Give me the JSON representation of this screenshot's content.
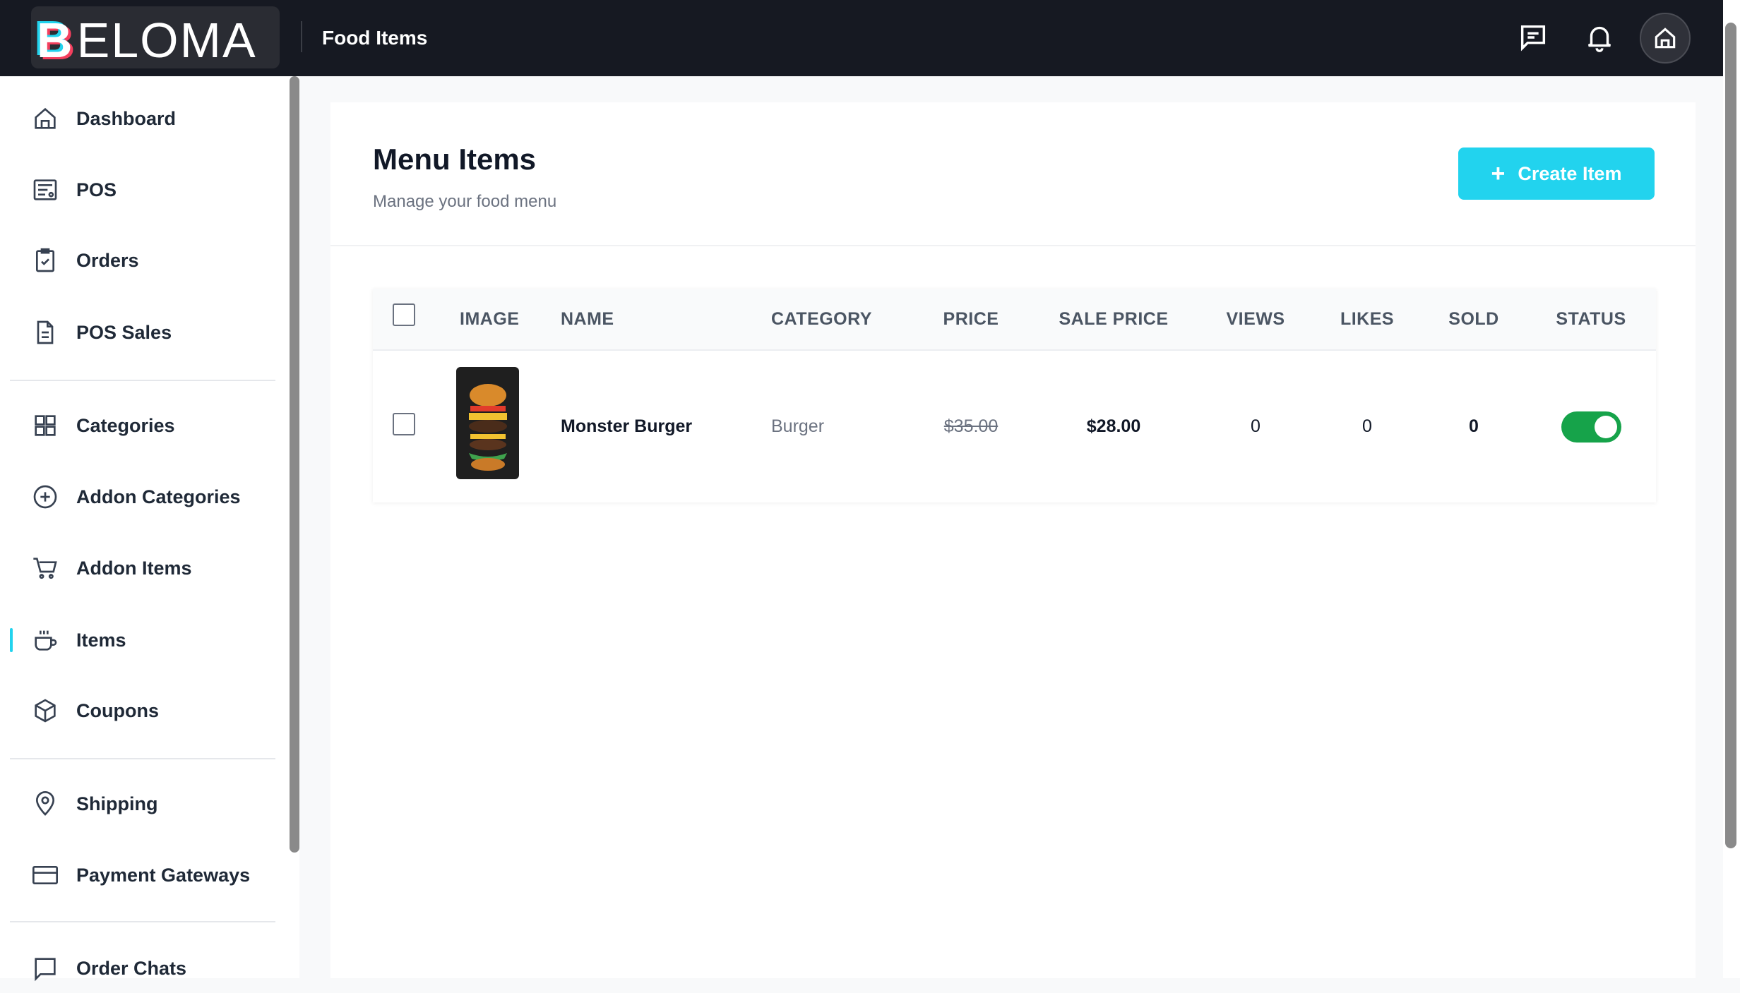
{
  "header": {
    "logo": "BELOMA",
    "page_title": "Food Items"
  },
  "sidebar": {
    "items": [
      {
        "label": "Dashboard",
        "icon": "home-icon"
      },
      {
        "label": "POS",
        "icon": "pos-icon"
      },
      {
        "label": "Orders",
        "icon": "clipboard-icon"
      },
      {
        "label": "POS Sales",
        "icon": "document-icon"
      },
      {
        "label": "Categories",
        "icon": "grid-icon"
      },
      {
        "label": "Addon Categories",
        "icon": "plus-circle-icon"
      },
      {
        "label": "Addon Items",
        "icon": "cart-icon"
      },
      {
        "label": "Items",
        "icon": "cup-icon",
        "active": true
      },
      {
        "label": "Coupons",
        "icon": "box-icon"
      },
      {
        "label": "Shipping",
        "icon": "map-pin-icon"
      },
      {
        "label": "Payment Gateways",
        "icon": "credit-card-icon"
      },
      {
        "label": "Order Chats",
        "icon": "chat-icon"
      }
    ]
  },
  "main": {
    "title": "Menu Items",
    "subtitle": "Manage your food menu",
    "create_label": "Create Item",
    "columns": [
      "IMAGE",
      "NAME",
      "CATEGORY",
      "PRICE",
      "SALE PRICE",
      "VIEWS",
      "LIKES",
      "SOLD",
      "STATUS"
    ],
    "rows": [
      {
        "name": "Monster Burger",
        "category": "Burger",
        "price": "$35.00",
        "sale_price": "$28.00",
        "views": "0",
        "likes": "0",
        "sold": "0",
        "status": true
      }
    ]
  },
  "colors": {
    "accent": "#22d3ee",
    "topbar": "#161922",
    "toggle_on": "#16a34a"
  }
}
